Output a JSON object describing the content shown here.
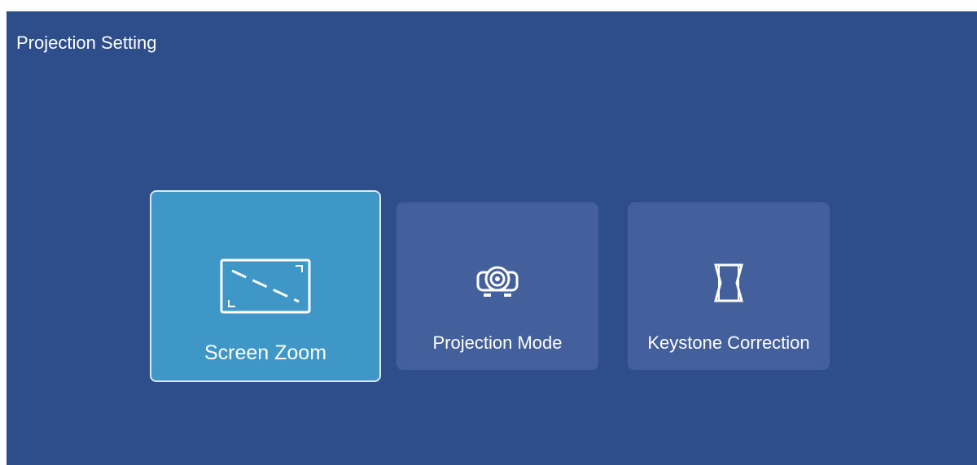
{
  "header": {
    "title": "Projection Setting"
  },
  "menu": {
    "items": [
      {
        "label": "Screen Zoom",
        "icon": "screen-zoom-icon",
        "selected": true
      },
      {
        "label": "Projection Mode",
        "icon": "projector-icon",
        "selected": false
      },
      {
        "label": "Keystone Correction",
        "icon": "keystone-icon",
        "selected": false
      }
    ]
  },
  "colors": {
    "background": "#2d4e8b",
    "tile": "#44609c",
    "tile_selected": "#3f97c8",
    "tile_selected_border": "#d6e9f5",
    "text": "#ffffff"
  }
}
